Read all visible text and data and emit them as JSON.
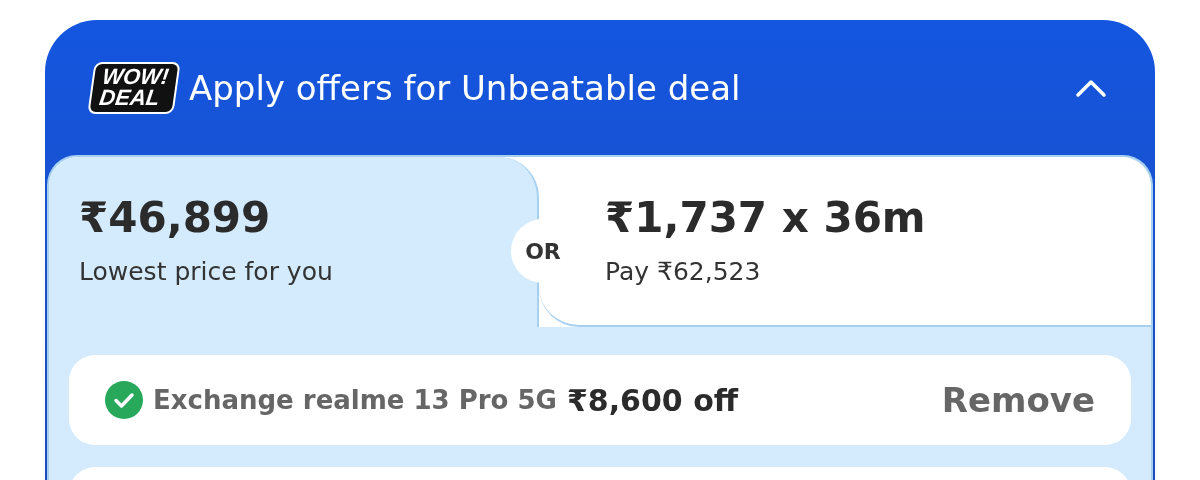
{
  "header": {
    "badge_lines": [
      "WOW!",
      "DEAL"
    ],
    "title": "Apply offers for Unbeatable deal",
    "expanded": true
  },
  "options": [
    {
      "price": "₹46,899",
      "caption": "Lowest price for you",
      "selected": true
    },
    {
      "price": "₹1,737 x 36m",
      "caption": "Pay ₹62,523",
      "selected": false
    }
  ],
  "separator": "OR",
  "applied_offer": {
    "applied": true,
    "label": "Exchange realme 13 Pro 5G",
    "amount": "₹8,600 off",
    "action": "Remove"
  }
}
